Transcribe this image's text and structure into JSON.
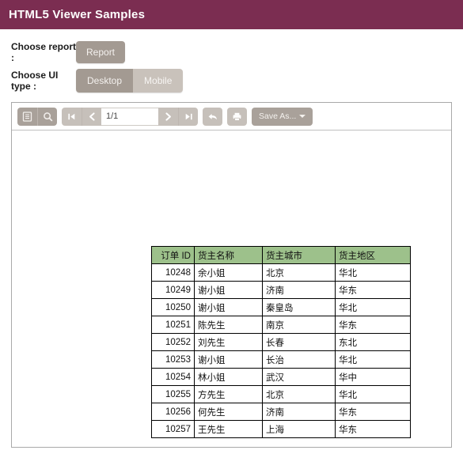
{
  "header": {
    "title": "HTML5 Viewer Samples",
    "bar_color": "#7b2d51"
  },
  "choosers": {
    "report": {
      "label": "Choose report :",
      "button_label": "Report"
    },
    "ui_type": {
      "label": "Choose UI type :",
      "options": [
        {
          "label": "Desktop",
          "selected": true
        },
        {
          "label": "Mobile",
          "selected": false
        }
      ]
    }
  },
  "viewer_toolbar": {
    "parameters_icon": "document-panel-icon",
    "search_icon": "search-icon",
    "first_page_icon": "first-page-icon",
    "prev_page_icon": "previous-page-icon",
    "page_value": "1/1",
    "page_placeholder": "1/1",
    "next_page_icon": "next-page-icon",
    "last_page_icon": "last-page-icon",
    "back_icon": "back-arrow-icon",
    "print_icon": "print-icon",
    "save_as_label": "Save As...",
    "save_as_caret": "chevron-down-icon"
  },
  "report": {
    "columns": [
      "订单 ID",
      "货主名称",
      "货主城市",
      "货主地区"
    ],
    "rows": [
      [
        "10248",
        "余小姐",
        "北京",
        "华北"
      ],
      [
        "10249",
        "谢小姐",
        "济南",
        "华东"
      ],
      [
        "10250",
        "谢小姐",
        "秦皇岛",
        "华北"
      ],
      [
        "10251",
        "陈先生",
        "南京",
        "华东"
      ],
      [
        "10252",
        "刘先生",
        "长春",
        "东北"
      ],
      [
        "10253",
        "谢小姐",
        "长治",
        "华北"
      ],
      [
        "10254",
        "林小姐",
        "武汉",
        "华中"
      ],
      [
        "10255",
        "方先生",
        "北京",
        "华北"
      ],
      [
        "10256",
        "何先生",
        "济南",
        "华东"
      ],
      [
        "10257",
        "王先生",
        "上海",
        "华东"
      ]
    ],
    "header_color": "#9dc18b"
  }
}
